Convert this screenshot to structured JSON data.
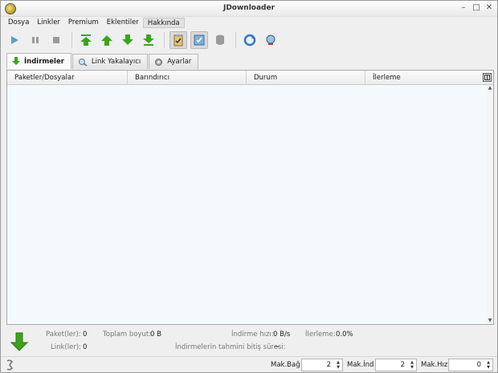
{
  "window": {
    "title": "JDownloader",
    "controls": {
      "minimize": "–",
      "maximize": "□",
      "close": "✕"
    }
  },
  "menu": [
    "Dosya",
    "Linkler",
    "Premium",
    "Eklentiler",
    "Hakkında"
  ],
  "toolbar": {
    "icons": [
      "play-icon",
      "pause-icon",
      "stop-icon",
      "move-top-icon",
      "move-up-icon",
      "move-down-icon",
      "move-bottom-icon",
      "clipboard-observer-icon",
      "auto-reconnect-icon",
      "premium-disabled-icon",
      "update-icon",
      "reconnect-icon"
    ]
  },
  "tabs": [
    {
      "label": "İndirmeler",
      "icon": "download-arrow-icon",
      "active": true
    },
    {
      "label": "Link Yakalayıcı",
      "icon": "link-grabber-icon",
      "active": false
    },
    {
      "label": "Ayarlar",
      "icon": "settings-gear-icon",
      "active": false
    }
  ],
  "table": {
    "columns": [
      "Paketler/Dosyalar",
      "Barındırıcı",
      "Durum",
      "İlerleme"
    ],
    "rows": []
  },
  "status": {
    "packages_label": "Paket(ler):",
    "packages_value": "0",
    "links_label": "Link(ler):",
    "links_value": "0",
    "total_size_label": "Toplam boyut:",
    "total_size_value": "0 B",
    "speed_label": "İndirme hızı:",
    "speed_value": "0 B/s",
    "progress_label": "İlerleme:",
    "progress_value": "0.0%",
    "eta_label": "İndirmelerin tahmini bitiş süresi:",
    "eta_value": "~"
  },
  "bottom": {
    "max_con_label": "Mak.Bağ",
    "max_con_value": "2",
    "max_dl_label": "Mak.İnd",
    "max_dl_value": "2",
    "max_speed_label": "Mak.Hız",
    "max_speed_value": "0"
  },
  "colors": {
    "green_arrow": "#3aa51c",
    "play_blue": "#5a9ec8",
    "table_bg": "#f3f9fc"
  }
}
